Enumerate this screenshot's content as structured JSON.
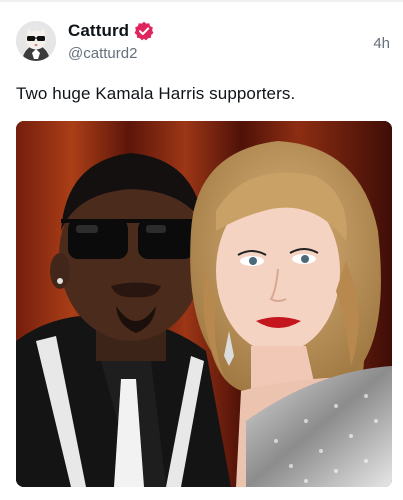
{
  "post": {
    "author": {
      "display_name": "Catturd",
      "handle": "@catturd2",
      "avatar_icon": "cat-avatar-icon",
      "verified_icon": "verified-badge-icon",
      "verified_color": "#e0245e"
    },
    "timestamp": "4h",
    "text": "Two huge Kamala Harris supporters.",
    "media": {
      "kind": "photo",
      "alt": ""
    }
  },
  "colors": {
    "text_primary": "#0f1419",
    "text_secondary": "#66707b",
    "background": "#ffffff"
  }
}
